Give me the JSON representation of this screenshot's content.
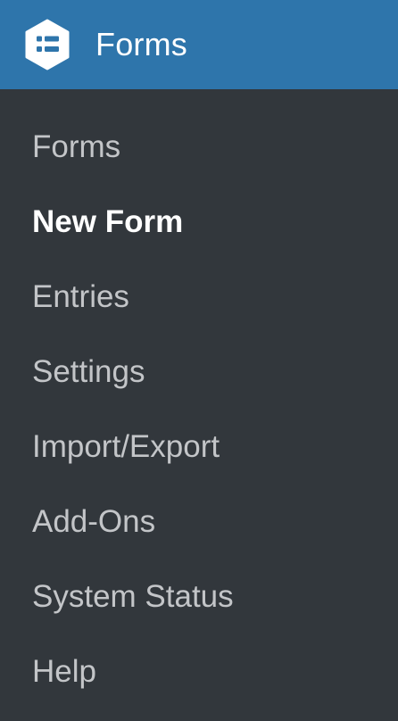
{
  "header": {
    "title": "Forms",
    "icon": "wpforms-hexagon-icon",
    "background": "#2e75ab"
  },
  "sidebar": {
    "background": "#32373c",
    "items": [
      {
        "label": "Forms",
        "current": false
      },
      {
        "label": "New Form",
        "current": true
      },
      {
        "label": "Entries",
        "current": false
      },
      {
        "label": "Settings",
        "current": false
      },
      {
        "label": "Import/Export",
        "current": false
      },
      {
        "label": "Add-Ons",
        "current": false
      },
      {
        "label": "System Status",
        "current": false
      },
      {
        "label": "Help",
        "current": false
      }
    ]
  }
}
